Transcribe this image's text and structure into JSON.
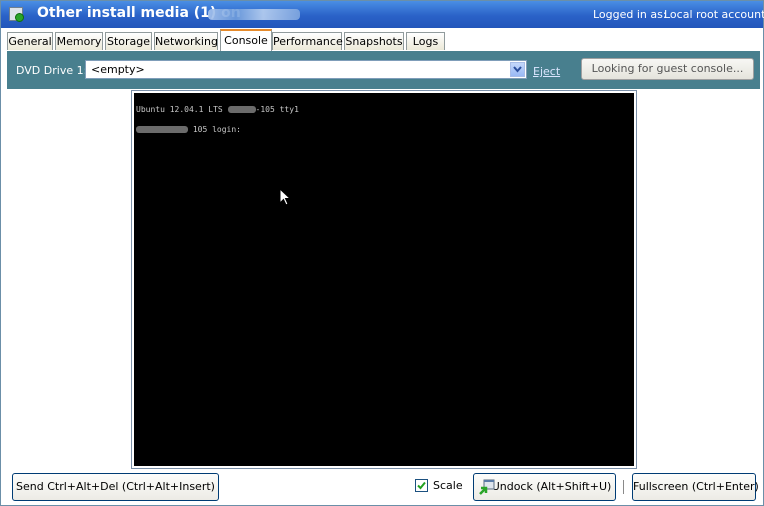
{
  "window": {
    "title": "Other install media (1) on",
    "login_label": "Logged in as:",
    "login_value": "Local root account"
  },
  "tabs": [
    {
      "label": "General"
    },
    {
      "label": "Memory"
    },
    {
      "label": "Storage"
    },
    {
      "label": "Networking"
    },
    {
      "label": "Console",
      "active": true
    },
    {
      "label": "Performance"
    },
    {
      "label": "Snapshots"
    },
    {
      "label": "Logs"
    }
  ],
  "dvd": {
    "label": "DVD Drive 1:",
    "value": "<empty>",
    "eject_label": "Eject",
    "guest_console_label": "Looking for guest console..."
  },
  "console": {
    "line1_prefix": "Ubuntu 12.04.1 LTS",
    "line1_suffix": "-105 tty1",
    "line2_suffix": "105 login:"
  },
  "bottom": {
    "send_cad_label": "Send Ctrl+Alt+Del (Ctrl+Alt+Insert)",
    "scale_label": "Scale",
    "scale_checked": true,
    "undock_label": "Undock (Alt+Shift+U)",
    "fullscreen_label": "Fullscreen (Ctrl+Enter)"
  },
  "colors": {
    "titlebar": "#2a62c8",
    "toolbar_panel": "#487f8e",
    "active_tab_accent": "#e68b2c",
    "console_bg": "#000000"
  },
  "icons": {
    "app": "vm-running-icon",
    "dropdown": "chevron-down-icon",
    "cursor": "mouse-pointer-icon",
    "undock": "undock-icon",
    "check": "checkmark-icon"
  }
}
